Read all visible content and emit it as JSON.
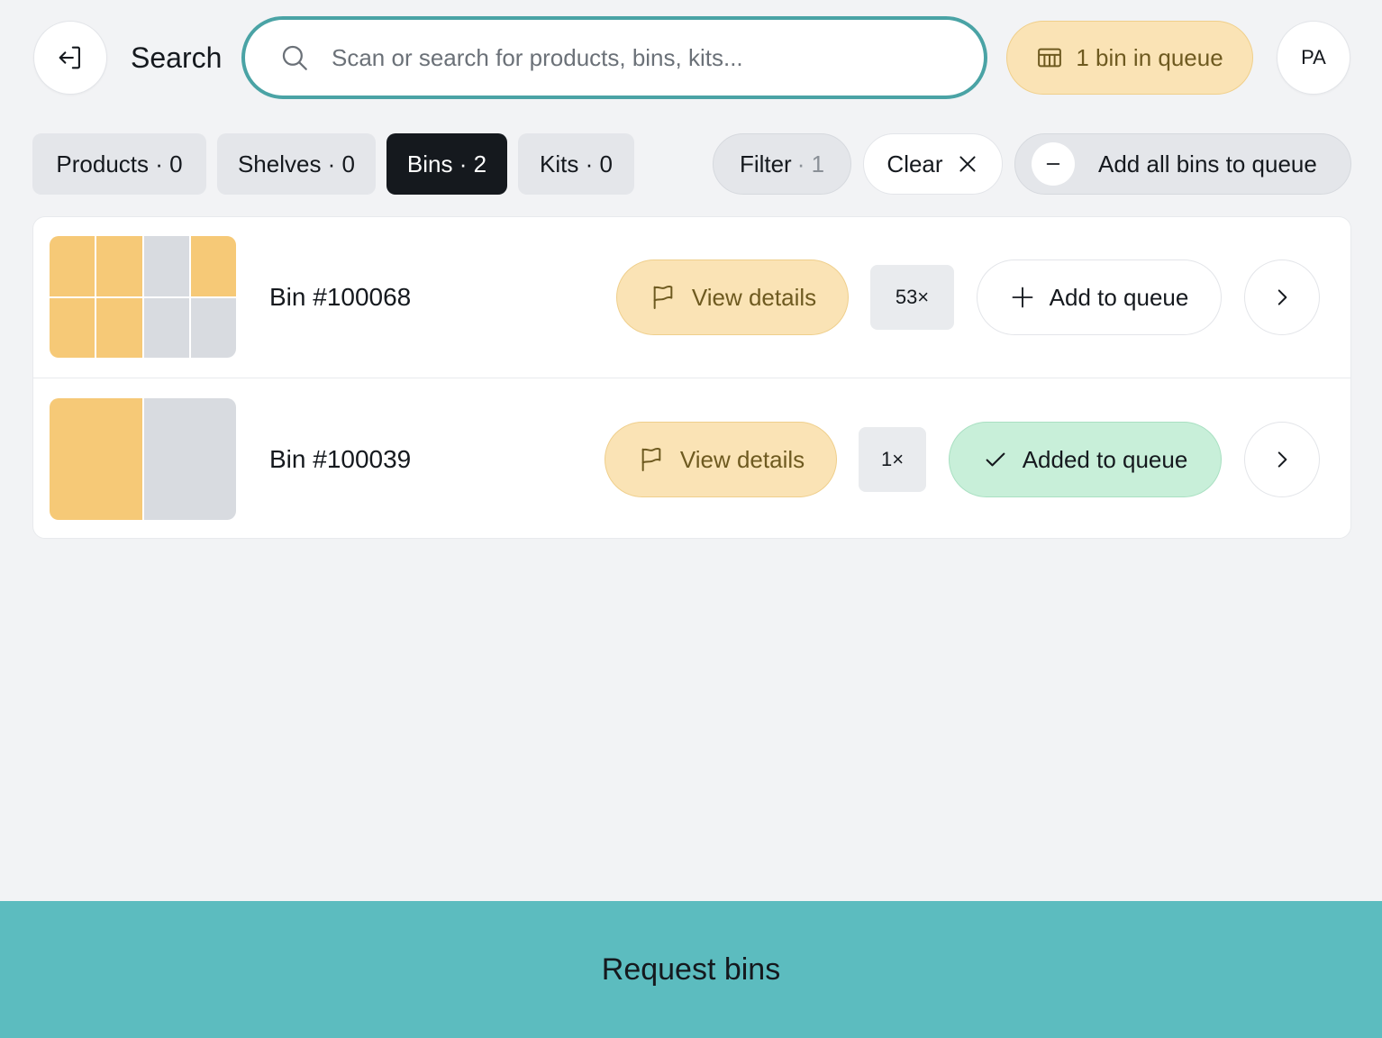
{
  "header": {
    "title": "Search",
    "search_placeholder": "Scan or search for products, bins, kits...",
    "search_value": "",
    "queue_label": "1 bin in queue",
    "avatar_initials": "PA"
  },
  "tabs": [
    {
      "label": "Products · 0",
      "active": false
    },
    {
      "label": "Shelves · 0",
      "active": false
    },
    {
      "label": "Bins · 2",
      "active": true
    },
    {
      "label": "Kits · 0",
      "active": false
    }
  ],
  "filters": {
    "filter_label": "Filter",
    "filter_count": "· 1",
    "clear_label": "Clear",
    "add_all_label": "Add all bins to queue"
  },
  "bins": [
    {
      "name": "Bin #100068",
      "details_label": "View details",
      "quantity": "53×",
      "queue_label": "Add to queue",
      "in_queue": false
    },
    {
      "name": "Bin #100039",
      "details_label": "View details",
      "quantity": "1×",
      "queue_label": "Added to queue",
      "in_queue": true
    }
  ],
  "footer": {
    "request_label": "Request bins"
  },
  "colors": {
    "accent": "#4aa3a5",
    "footer": "#5cbcbf",
    "queue_pill": "#fae3b5",
    "added": "#c8efd9",
    "bin_filled": "#f6c977",
    "bin_empty": "#d8dbe0"
  }
}
